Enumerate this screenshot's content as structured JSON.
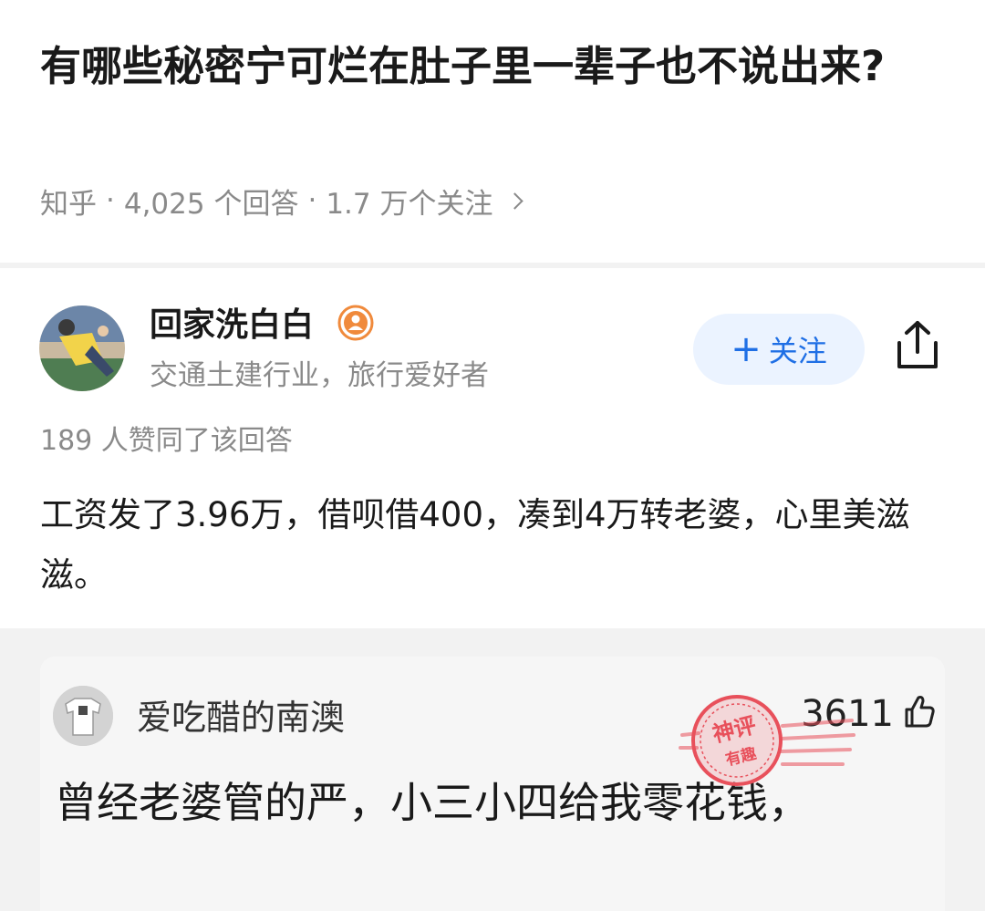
{
  "question": {
    "title": "有哪些秘密宁可烂在肚子里一辈子也不说出来?",
    "source": "知乎",
    "answer_count": "4,025 个回答",
    "follower_count": "1.7 万个关注"
  },
  "answer": {
    "author_name": "回家洗白白",
    "author_bio": "交通土建行业，旅行爱好者",
    "follow_label": "关注",
    "likes_summary": "189 人赞同了该回答",
    "content": "工资发了3.96万，借呗借400，凑到4万转老婆，心里美滋滋。"
  },
  "comment": {
    "user": "爱吃醋的南澳",
    "like_count": "3611",
    "text": "曾经老婆管的严，小三小四给我零花钱，"
  },
  "stamp": {
    "line1": "神评",
    "line2": "有趣"
  },
  "colors": {
    "accent": "#1f6fe5",
    "follow_bg": "#ebf3ff",
    "badge": "#f08a3c",
    "stamp": "#e8505b",
    "muted_text": "#8a8a8a"
  },
  "icons": [
    "chevron-right-icon",
    "plus-icon",
    "share-icon",
    "badge-icon",
    "thumbs-up-icon"
  ]
}
